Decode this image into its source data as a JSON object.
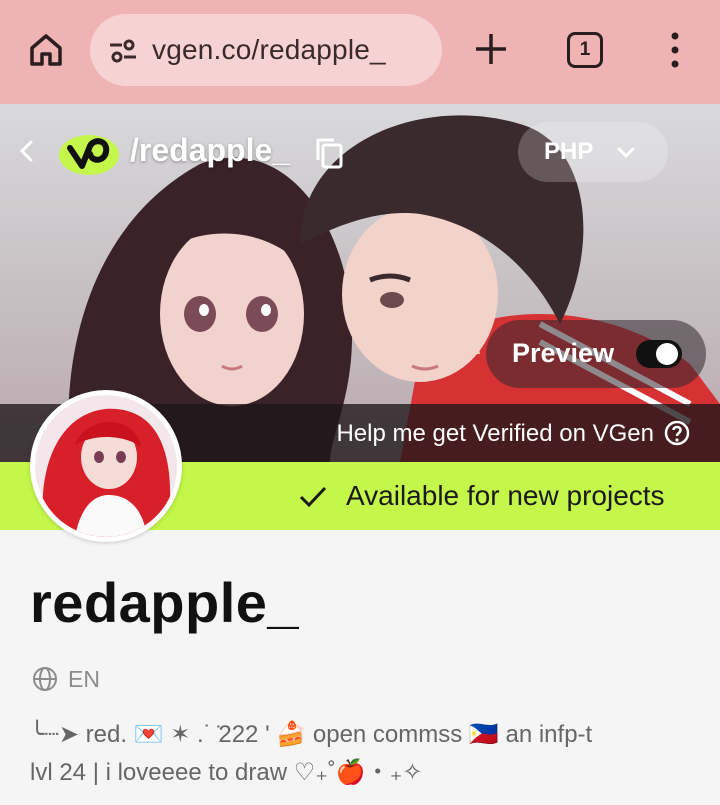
{
  "browser": {
    "url": "vgen.co/redapple_",
    "tab_count": "1"
  },
  "banner": {
    "handle": "/redapple_",
    "currency": "PHP",
    "preview_label": "Preview",
    "preview_on": true
  },
  "verify": {
    "text": "Help me get Verified on VGen"
  },
  "availability": {
    "text": "Available for new projects",
    "accent": "#c4f74a"
  },
  "profile": {
    "name": "redapple_",
    "language": "EN",
    "bio_line1": "╰┈➤ red. 💌 ✶ .˙ ̇222 ' 🍰 open commss 🇵🇭 an infp-t",
    "bio_line2": "lvl 24 | i loveeee to draw ♡₊˚🍎・₊✧"
  },
  "colors": {
    "chrome": "#efb3b4",
    "vgen_green": "#c4f74a"
  }
}
